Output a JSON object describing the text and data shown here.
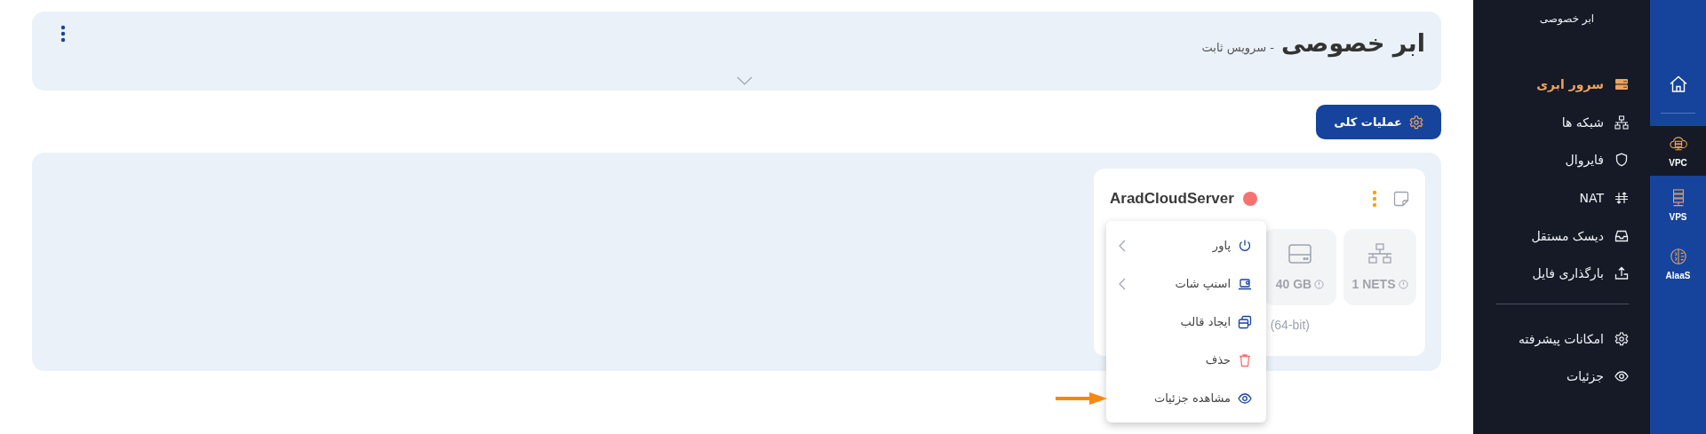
{
  "header": {
    "title": "ابر خصوصی",
    "subtitle": "- سرویس ثابت"
  },
  "actions_button": {
    "label": "عملیات کلی"
  },
  "servers": [
    {
      "name": "AradCloudServer",
      "color": "#f87171",
      "specs": [
        {
          "kind": "network",
          "value": "1 NETS"
        },
        {
          "kind": "disk",
          "value": "40 GB"
        }
      ],
      "os_text": "(64-bit)",
      "menu": [
        {
          "kind": "power",
          "label": "پاور",
          "submenu": true
        },
        {
          "kind": "snapshot",
          "label": "اسنپ شات",
          "submenu": true
        },
        {
          "kind": "template",
          "label": "ایجاد قالب",
          "submenu": false
        },
        {
          "kind": "delete",
          "label": "حذف",
          "submenu": false
        },
        {
          "kind": "details",
          "label": "مشاهده جزئیات",
          "submenu": false
        }
      ]
    }
  ],
  "sidebar": {
    "title": "ابر خصوصی",
    "items": [
      {
        "kind": "server",
        "label": "سرور ابری",
        "selected": true
      },
      {
        "kind": "network",
        "label": "شبکه ها",
        "selected": false
      },
      {
        "kind": "firewall",
        "label": "فایروال",
        "selected": false
      },
      {
        "kind": "nat",
        "label": "NAT",
        "selected": false
      },
      {
        "kind": "disk",
        "label": "دیسک مستقل",
        "selected": false
      },
      {
        "kind": "upload",
        "label": "بارگذاری فایل",
        "selected": false
      }
    ],
    "extra_items": [
      {
        "kind": "settings",
        "label": "امکانات پیشرفته",
        "selected": false
      },
      {
        "kind": "details",
        "label": "جزئیات",
        "selected": false
      }
    ]
  },
  "rail": [
    {
      "kind": "home",
      "selected": false
    },
    {
      "kind": "vpc",
      "label": "VPC",
      "selected": true
    },
    {
      "kind": "vps",
      "label": "VPS",
      "selected": false
    },
    {
      "kind": "ai",
      "label": "AIaaS",
      "selected": false
    }
  ]
}
